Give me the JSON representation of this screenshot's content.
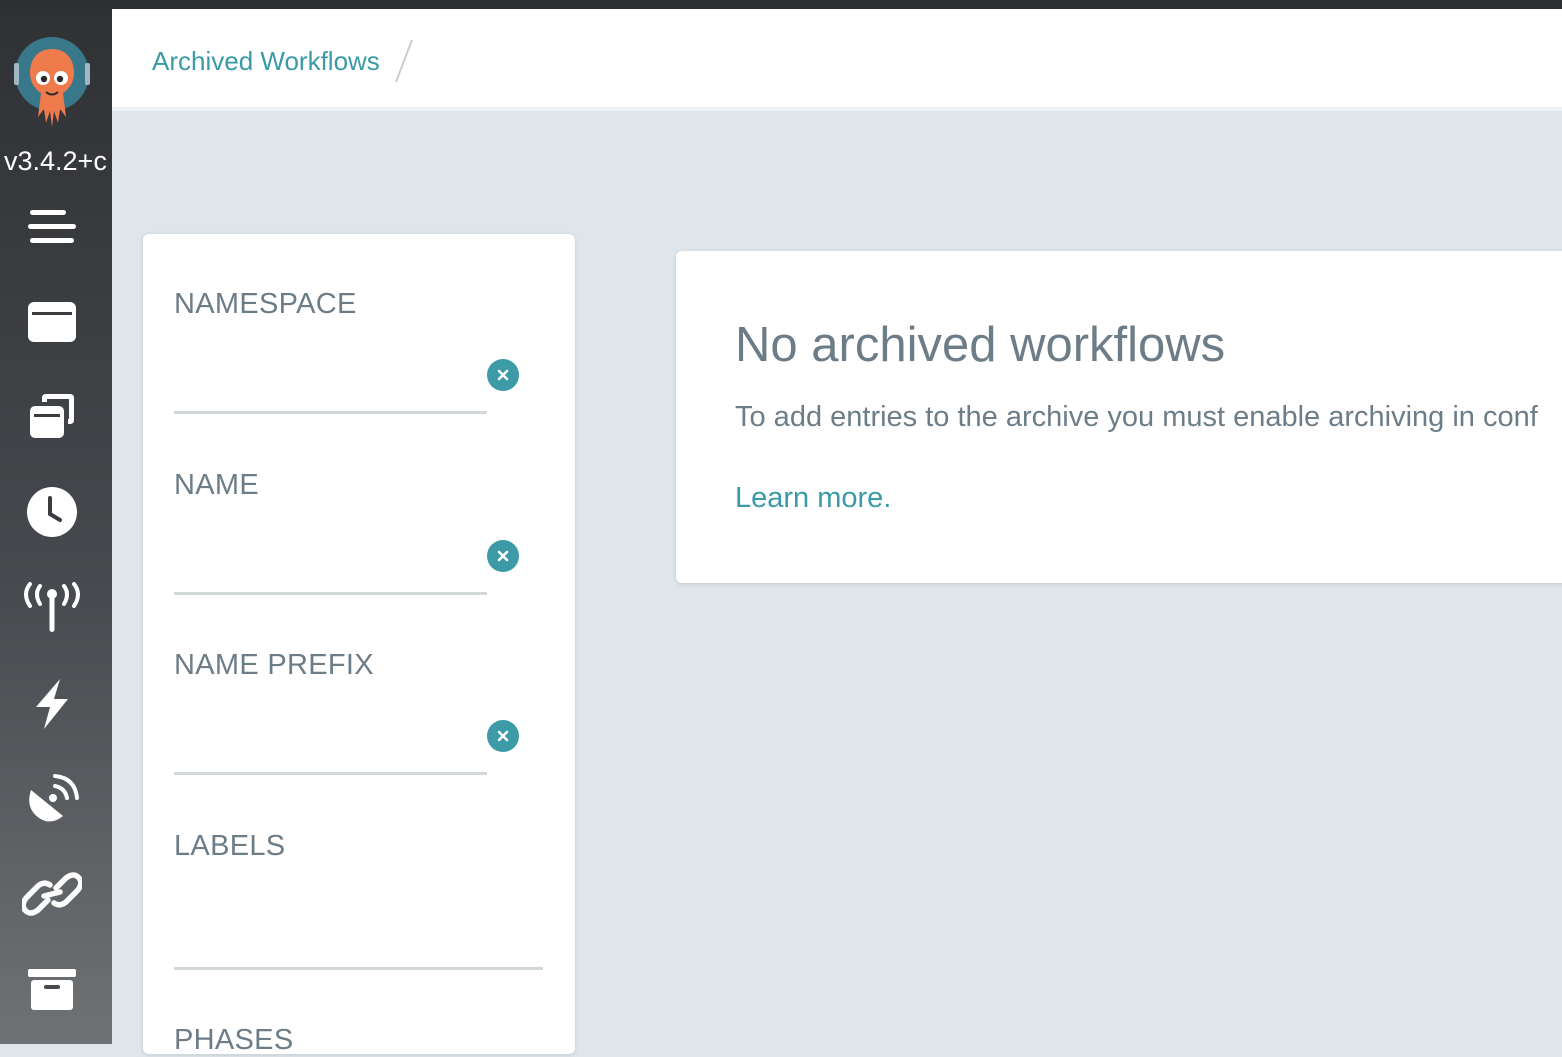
{
  "app": {
    "version": "v3.4.2+c"
  },
  "sidebar": {
    "items": [
      {
        "name": "menu",
        "icon": "hamburger-menu-icon"
      },
      {
        "name": "workflows",
        "icon": "window-icon"
      },
      {
        "name": "workflow-templates",
        "icon": "stacked-windows-icon"
      },
      {
        "name": "cron-workflows",
        "icon": "clock-icon"
      },
      {
        "name": "event-sources",
        "icon": "broadcast-tower-icon"
      },
      {
        "name": "sensors",
        "icon": "lightning-bolt-icon"
      },
      {
        "name": "event-flow",
        "icon": "satellite-dish-icon"
      },
      {
        "name": "links",
        "icon": "chain-link-icon"
      },
      {
        "name": "archived-workflows",
        "icon": "archive-box-icon"
      }
    ]
  },
  "header": {
    "breadcrumb": "Archived Workflows"
  },
  "filters": {
    "namespace_label": "NAMESPACE",
    "namespace_value": "",
    "name_label": "NAME",
    "name_value": "",
    "name_prefix_label": "NAME PREFIX",
    "name_prefix_value": "",
    "labels_label": "LABELS",
    "labels_value": "",
    "phases_label": "PHASES"
  },
  "empty_state": {
    "title": "No archived workflows",
    "text": "To add entries to the archive you must enable archiving in conf",
    "link": "Learn more."
  },
  "colors": {
    "accent": "#3a9ba6",
    "text_muted": "#6d7d88",
    "sidebar": "#2f3134",
    "background": "#dee6eb"
  }
}
